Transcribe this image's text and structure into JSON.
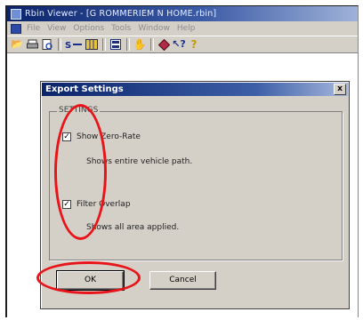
{
  "window": {
    "title": "Rbin Viewer - [G ROMMERIEM N HOME.rbin]"
  },
  "menu": {
    "items": [
      "File",
      "View",
      "Options",
      "Tools",
      "Window",
      "Help"
    ]
  },
  "toolbar": {
    "icons": [
      "open-folder-icon",
      "print-icon",
      "print-preview-icon",
      "route-icon",
      "map-icon",
      "list-icon",
      "hand-icon",
      "diamond-icon",
      "help-cursor-icon",
      "question-icon"
    ]
  },
  "dialog": {
    "title": "Export Settings",
    "close_label": "x",
    "group_label": "SETTINGS",
    "option1": {
      "label": "Show Zero-Rate",
      "description": "Shows entire vehicle path.",
      "checked_mark": "✓"
    },
    "option2": {
      "label": "Filter Overlap",
      "description": "Shows all area applied.",
      "checked_mark": "✓"
    },
    "ok_label": "OK",
    "cancel_label": "Cancel"
  },
  "colors": {
    "annotation": "#e8141a",
    "title_gradient_start": "#0a246a",
    "dialog_bg": "#d4d0c8"
  }
}
